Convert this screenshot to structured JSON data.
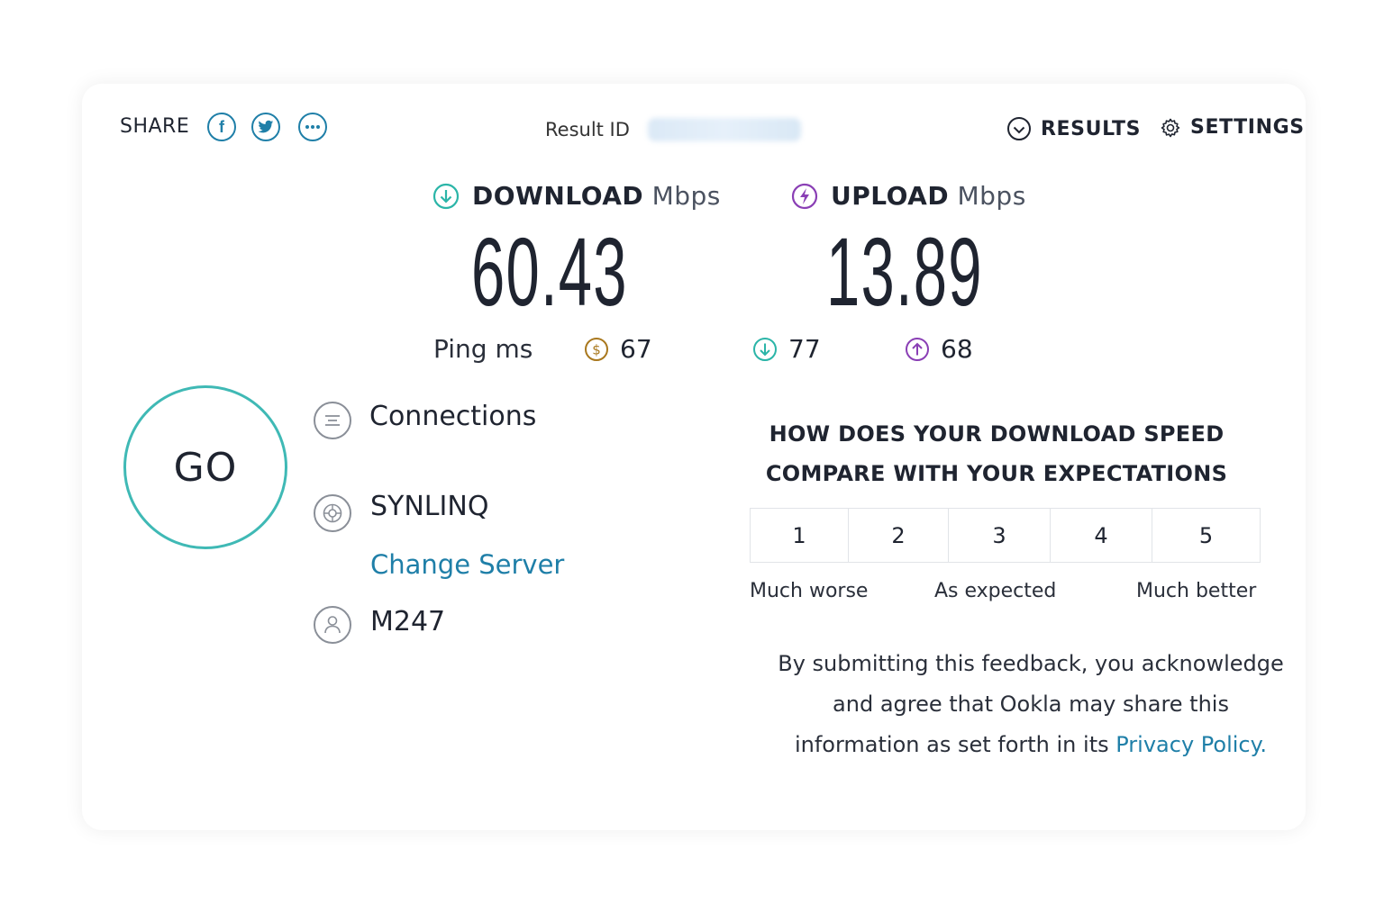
{
  "header": {
    "share_label": "SHARE",
    "share_buttons": [
      "facebook-icon",
      "twitter-icon",
      "more-icon"
    ],
    "result_id_label": "Result ID",
    "results_label": "RESULTS",
    "settings_label": "SETTINGS"
  },
  "metrics": {
    "download": {
      "label": "DOWNLOAD",
      "unit": "Mbps",
      "value": "60.43",
      "color": "#2bb5a8"
    },
    "upload": {
      "label": "UPLOAD",
      "unit": "Mbps",
      "value": "13.89",
      "color": "#8a3fb5"
    }
  },
  "ping": {
    "label": "Ping ms",
    "idle": {
      "value": "67",
      "color": "#a9781e",
      "icon": "ping-idle-icon"
    },
    "download": {
      "value": "77",
      "color": "#2bb5a8",
      "icon": "ping-download-icon"
    },
    "upload": {
      "value": "68",
      "color": "#8a3fb5",
      "icon": "ping-upload-icon"
    }
  },
  "go_label": "GO",
  "info": {
    "connections": "Connections",
    "server": "SYNLINQ",
    "change_server": "Change Server",
    "isp": "M247"
  },
  "feedback": {
    "question_line1": "HOW DOES YOUR DOWNLOAD SPEED",
    "question_line2": "COMPARE WITH YOUR EXPECTATIONS",
    "ratings": [
      "1",
      "2",
      "3",
      "4",
      "5"
    ],
    "scale_low": "Much worse",
    "scale_mid": "As expected",
    "scale_high": "Much better",
    "disclaimer_line1": "By submitting this feedback, you acknowledge",
    "disclaimer_line2": "and agree that Ookla may share this",
    "disclaimer_line3": "information as set forth in its",
    "privacy_link": "Privacy Policy."
  },
  "colors": {
    "accent": "#1f7fa8",
    "go_ring": "#3fb9b5"
  }
}
